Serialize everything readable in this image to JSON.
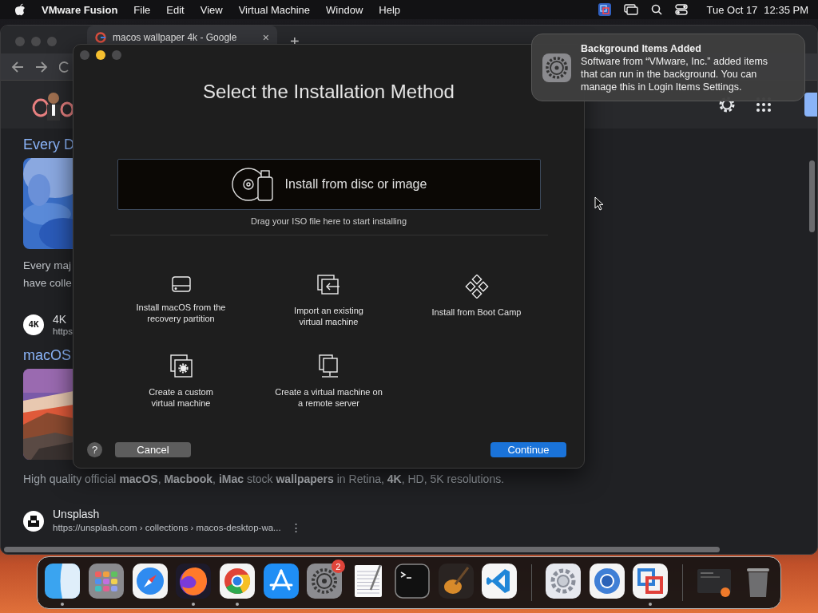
{
  "menu_bar": {
    "app_name": "VMware Fusion",
    "menus": [
      "File",
      "Edit",
      "View",
      "Virtual Machine",
      "Window",
      "Help"
    ],
    "date": "Tue Oct 17",
    "time": "12:35 PM"
  },
  "browser": {
    "tab": {
      "title": "macos wallpaper 4k - Google",
      "selected": true,
      "close": "×"
    },
    "new_tab": "+",
    "results": [
      {
        "kind": "title",
        "text": "Every D"
      },
      {
        "kind": "picture"
      },
      {
        "kind": "snippet",
        "text": "Every maj"
      },
      {
        "kind": "snippet",
        "text": "have colle"
      },
      {
        "kind": "site",
        "logo": "4K",
        "name": "4K",
        "url": "https"
      },
      {
        "kind": "title",
        "text": "macOS"
      },
      {
        "kind": "picture"
      },
      {
        "kind": "description",
        "text": "High quality official **macOS**, **Macbook**, **iMac** stock **wallpapers** in Retina, **4K**, HD, 5K resolutions."
      },
      {
        "kind": "site",
        "name": "Unsplash",
        "url": "https://unsplash.com › collections › macos-desktop-wa...",
        "more": "⋮"
      }
    ]
  },
  "dialog": {
    "title": "Select the Installation Method",
    "primary": {
      "label": "Install from disc or image",
      "hint": "Drag your ISO file here to start installing"
    },
    "options": [
      {
        "kind": "drive",
        "label": "Install macOS from the\nrecovery partition"
      },
      {
        "kind": "import",
        "label": "Import an existing\nvirtual machine"
      },
      {
        "kind": "diamonds",
        "label": "Install from Boot Camp"
      },
      {
        "kind": "custom",
        "label": "Create a custom\nvirtual machine"
      },
      {
        "kind": "remote",
        "label": "Create a virtual machine on\na remote server"
      }
    ],
    "help": "?",
    "buttons": [
      {
        "label": "Cancel",
        "default": false
      },
      {
        "label": "Continue",
        "default": true
      }
    ]
  },
  "notification": {
    "title": "Background Items Added",
    "body": "Software from “VMware, Inc.” added items\nthat can run in the background. You can\nmanage this in Login Items Settings."
  },
  "dock": [
    {
      "kind": "face",
      "running": true
    },
    {
      "kind": "grid",
      "running": false
    },
    {
      "kind": "compass",
      "running": false
    },
    {
      "kind": "flame",
      "running": true
    },
    {
      "kind": "ring3",
      "running": true
    },
    {
      "kind": "sticks",
      "running": false
    },
    {
      "kind": "gear",
      "running": false,
      "badge": "2"
    },
    {
      "kind": "notepad",
      "running": false
    },
    {
      "kind": "terminal",
      "running": false
    },
    {
      "kind": "guitar",
      "running": false
    },
    {
      "kind": "ribbon",
      "running": false
    },
    {
      "kind": "separator"
    },
    {
      "kind": "cog",
      "running": false
    },
    {
      "kind": "ring",
      "running": false
    },
    {
      "kind": "squares",
      "running": true
    },
    {
      "kind": "separator"
    },
    {
      "kind": "thumb",
      "running": false
    },
    {
      "kind": "trash",
      "running": false
    }
  ]
}
